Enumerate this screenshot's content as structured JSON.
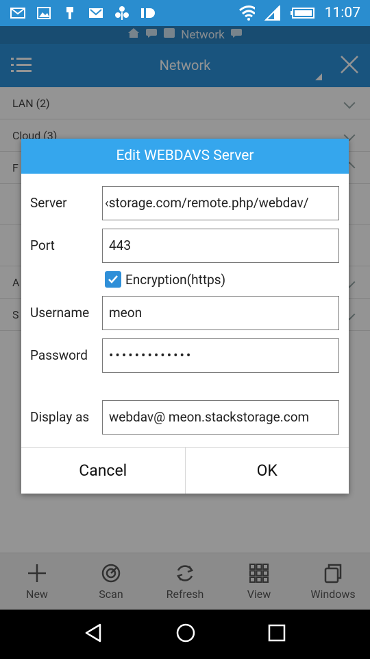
{
  "status_bar": {
    "time": "11:07"
  },
  "subheader": {
    "label": "Network"
  },
  "appbar": {
    "title": "Network"
  },
  "background_list": [
    {
      "label": "LAN (2)",
      "chevron": "down"
    },
    {
      "label": "Cloud (3)",
      "chevron": "down"
    },
    {
      "label": "F",
      "chevron": "up"
    },
    {
      "label": "",
      "chevron": ""
    },
    {
      "label": "",
      "chevron": ""
    },
    {
      "label": "A",
      "chevron": "down"
    },
    {
      "label": "S",
      "chevron": "down"
    }
  ],
  "dialog": {
    "title": "Edit WEBDAVS Server",
    "server": {
      "label": "Server",
      "value": "‹storage.com/remote.php/webdav/"
    },
    "port": {
      "label": "Port",
      "value": "443"
    },
    "encryption": {
      "label": "Encryption(https)",
      "checked": true
    },
    "username": {
      "label": "Username",
      "value": "meon"
    },
    "password": {
      "label": "Password",
      "value": "•••••••••••••"
    },
    "display_as": {
      "label": "Display as",
      "value": "webdav@ meon.stackstorage.com"
    },
    "cancel_label": "Cancel",
    "ok_label": "OK"
  },
  "toolbar": [
    {
      "label": "New",
      "icon": "plus-icon"
    },
    {
      "label": "Scan",
      "icon": "scan-icon"
    },
    {
      "label": "Refresh",
      "icon": "refresh-icon"
    },
    {
      "label": "View",
      "icon": "grid-icon"
    },
    {
      "label": "Windows",
      "icon": "windows-icon"
    }
  ]
}
